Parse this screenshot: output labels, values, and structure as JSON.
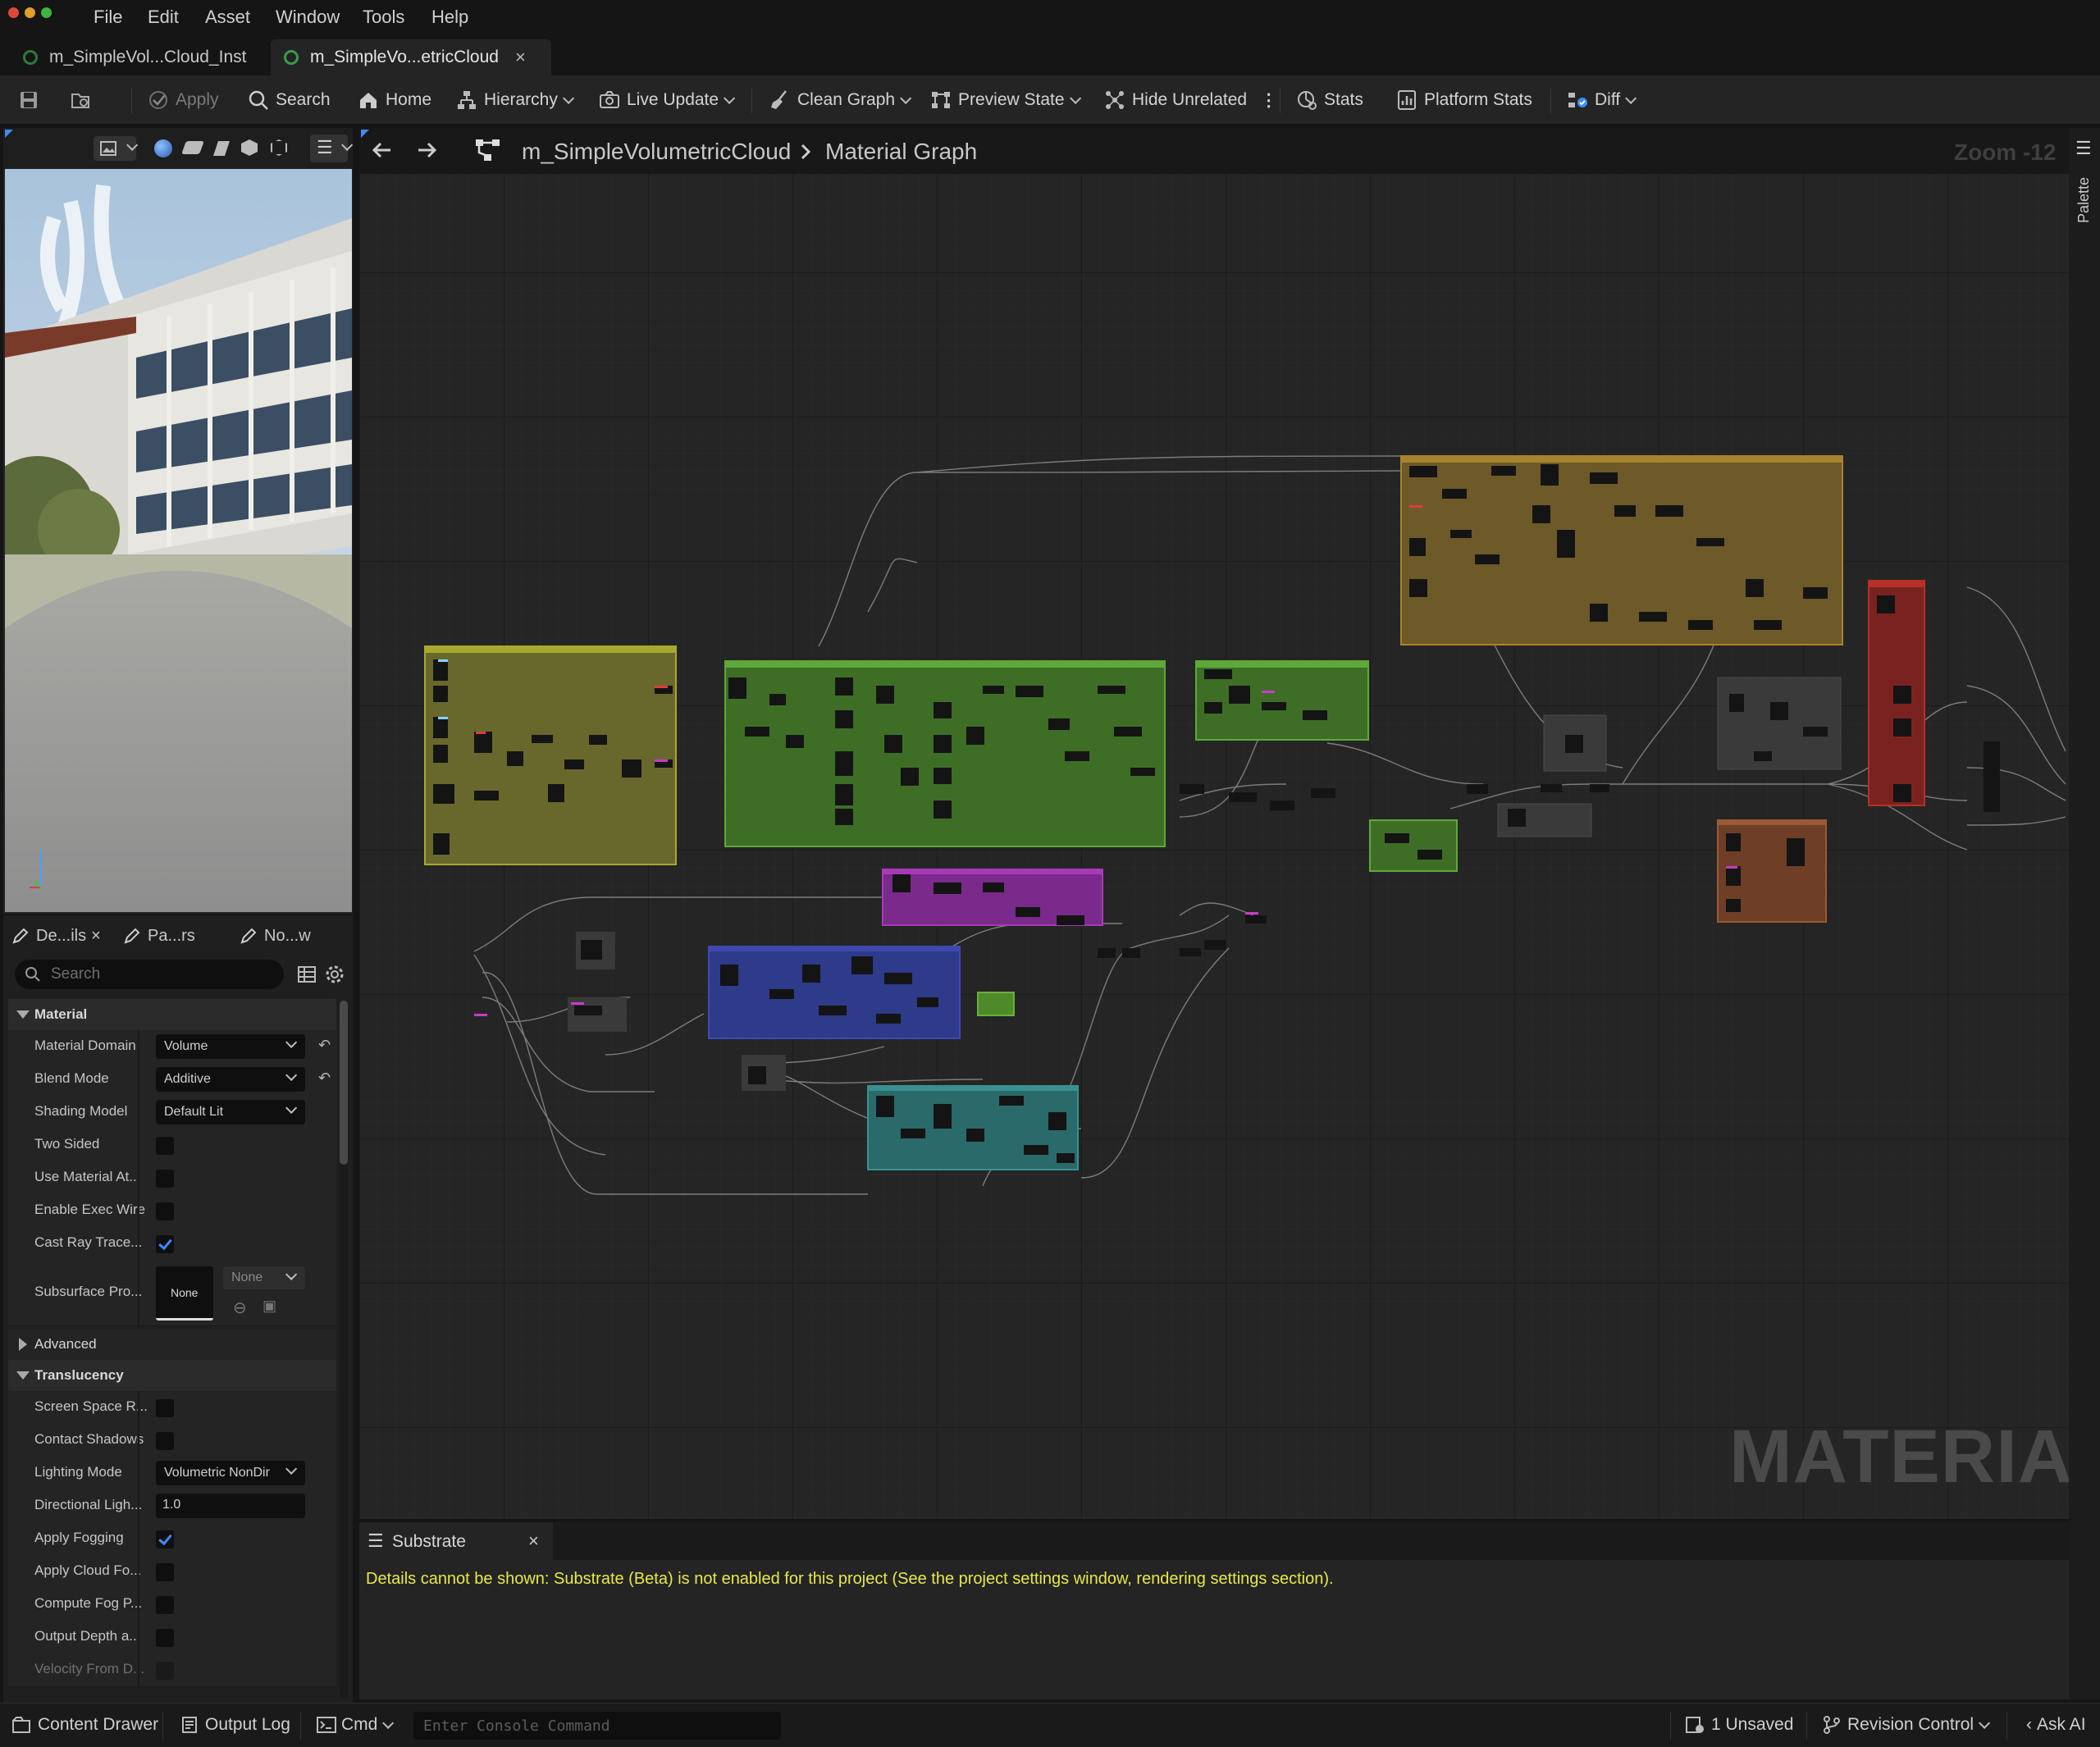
{
  "menubar": {
    "items": [
      "File",
      "Edit",
      "Asset",
      "Window",
      "Tools",
      "Help"
    ]
  },
  "tabs": [
    {
      "label": "m_SimpleVol...Cloud_Inst",
      "active": false
    },
    {
      "label": "m_SimpleVo...etricCloud",
      "active": true
    }
  ],
  "toolbar": {
    "apply": "Apply",
    "search": "Search",
    "home": "Home",
    "hierarchy": "Hierarchy",
    "live_update": "Live Update",
    "clean_graph": "Clean Graph",
    "preview_state": "Preview State",
    "hide_unrelated": "Hide Unrelated",
    "stats": "Stats",
    "platform_stats": "Platform Stats",
    "diff": "Diff"
  },
  "details": {
    "tabs": [
      "De...ils",
      "Pa...rs",
      "No...w"
    ],
    "search_placeholder": "Search",
    "sections": {
      "material": "Material",
      "advanced": "Advanced",
      "translucency": "Translucency"
    },
    "material_props": [
      {
        "label": "Material Domain",
        "type": "combo",
        "value": "Volume",
        "reset": true
      },
      {
        "label": "Blend Mode",
        "type": "combo",
        "value": "Additive",
        "reset": true
      },
      {
        "label": "Shading Model",
        "type": "combo",
        "value": "Default Lit",
        "reset": false
      },
      {
        "label": "Two Sided",
        "type": "check",
        "checked": false
      },
      {
        "label": "Use Material At...",
        "type": "check",
        "checked": false
      },
      {
        "label": "Enable Exec Wire",
        "type": "check",
        "checked": false
      },
      {
        "label": "Cast Ray Trace...",
        "type": "check",
        "checked": true
      }
    ],
    "subsurface": {
      "label": "Subsurface Pro...",
      "thumb": "None",
      "combo": "None"
    },
    "translucency_props": [
      {
        "label": "Screen Space R...",
        "type": "check",
        "checked": false
      },
      {
        "label": "Contact Shadows",
        "type": "check",
        "checked": false
      },
      {
        "label": "Lighting Mode",
        "type": "combo",
        "value": "Volumetric NonDir"
      },
      {
        "label": "Directional Ligh...",
        "type": "text",
        "value": "1.0"
      },
      {
        "label": "Apply Fogging",
        "type": "check",
        "checked": true
      },
      {
        "label": "Apply Cloud Fo...",
        "type": "check",
        "checked": false
      },
      {
        "label": "Compute Fog P...",
        "type": "check",
        "checked": false
      },
      {
        "label": "Output Depth a...",
        "type": "check",
        "checked": false
      },
      {
        "label": "Velocity From D...",
        "type": "check",
        "checked": false
      }
    ]
  },
  "graph": {
    "breadcrumb_asset": "m_SimpleVolumetricCloud",
    "breadcrumb_page": "Material Graph",
    "zoom": "Zoom -12",
    "watermark": "MATERIAL",
    "palette": "Palette"
  },
  "substrate": {
    "title": "Substrate",
    "message": "Details cannot be shown: Substrate (Beta) is not enabled for this project (See the project settings window, rendering settings section)."
  },
  "statusbar": {
    "content_drawer": "Content Drawer",
    "output_log": "Output Log",
    "cmd": "Cmd",
    "console_placeholder": "Enter Console Command",
    "unsaved": "1 Unsaved",
    "revision_control": "Revision Control",
    "ask_ai": "Ask AI"
  },
  "colors": {
    "accent": "#3d8cff",
    "substrate_message": "#e8e84a",
    "comment_olive": "#8c8a2a",
    "comment_green": "#4e8a2a",
    "comment_brown": "#8a6a28",
    "comment_red": "#9a2a26",
    "comment_purple": "#8a2a9a",
    "comment_blue": "#2e3a8a",
    "comment_teal": "#2a7a7a",
    "comment_orange": "#8a4a2a"
  }
}
